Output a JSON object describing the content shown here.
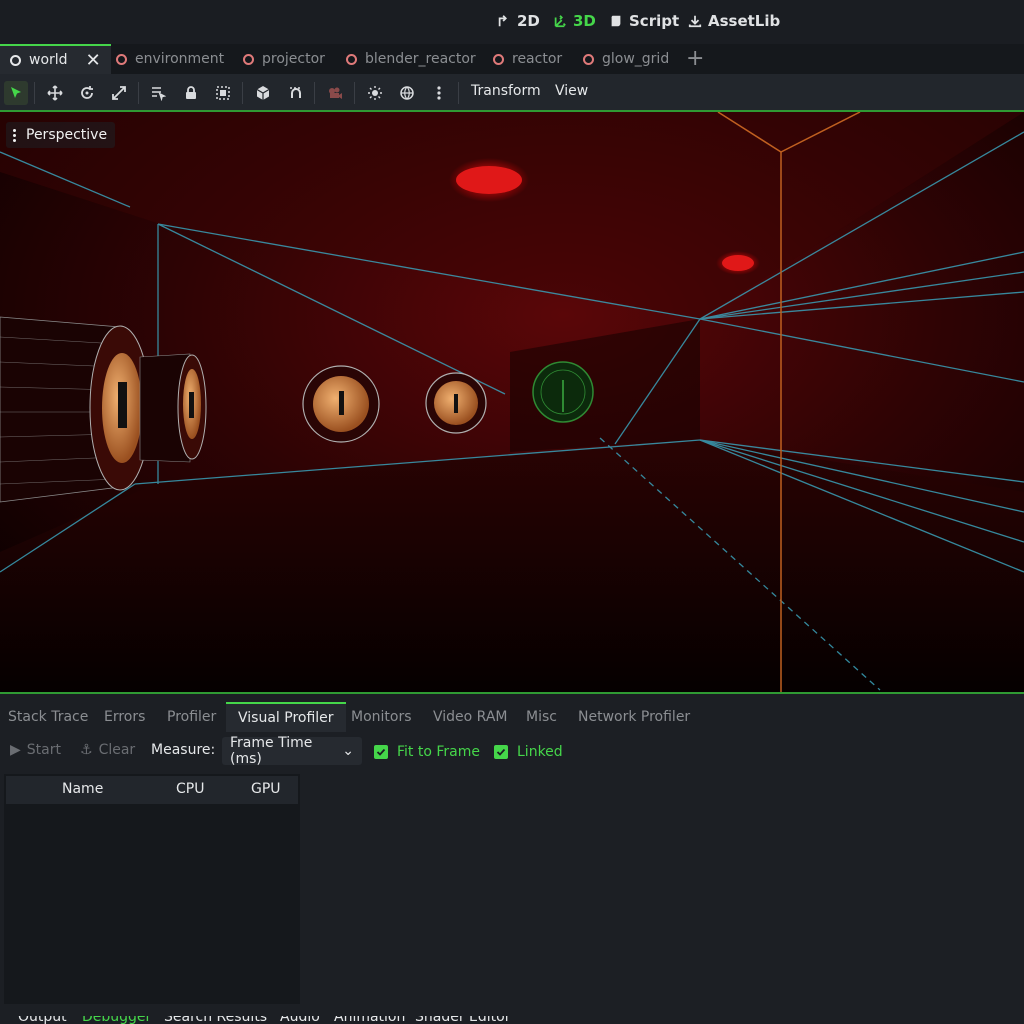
{
  "workspaces": [
    {
      "label": "2D",
      "icon": "2d-icon",
      "active": false
    },
    {
      "label": "3D",
      "icon": "3d-icon",
      "active": true
    },
    {
      "label": "Script",
      "icon": "script-icon",
      "active": false
    },
    {
      "label": "AssetLib",
      "icon": "assetlib-icon",
      "active": false
    }
  ],
  "scene_tabs": [
    {
      "label": "world",
      "active": true
    },
    {
      "label": "environment"
    },
    {
      "label": "projector"
    },
    {
      "label": "blender_reactor"
    },
    {
      "label": "reactor"
    },
    {
      "label": "glow_grid"
    }
  ],
  "toolbar": {
    "transform_label": "Transform",
    "view_label": "View"
  },
  "viewport": {
    "mode_label": "Perspective"
  },
  "debugger_tabs": [
    "Stack Trace",
    "Errors",
    "Profiler",
    "Visual Profiler",
    "Monitors",
    "Video RAM",
    "Misc",
    "Network Profiler"
  ],
  "active_debugger_tab": "Visual Profiler",
  "profiler": {
    "start_label": "Start",
    "clear_label": "Clear",
    "measure_label": "Measure:",
    "measure_value": "Frame Time (ms)",
    "fit_to_frame_label": "Fit to Frame",
    "linked_label": "Linked",
    "columns": [
      "Name",
      "CPU",
      "GPU"
    ]
  },
  "status_tabs": [
    "Output",
    "Debugger",
    "Search Results",
    "Audio",
    "Animation",
    "Shader Editor"
  ],
  "colors": {
    "accent": "#45d64a",
    "tab_dot": "#e07a7a"
  }
}
